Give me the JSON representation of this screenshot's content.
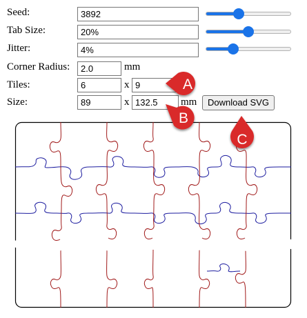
{
  "fields": {
    "seed": {
      "label": "Seed:",
      "value": "3892"
    },
    "tab_size": {
      "label": "Tab Size:",
      "value": "20%"
    },
    "jitter": {
      "label": "Jitter:",
      "value": "4%"
    },
    "corner_radius": {
      "label": "Corner Radius:",
      "value": "2.0",
      "unit": "mm"
    },
    "tiles": {
      "label": "Tiles:",
      "value_x": "6",
      "separator": "x",
      "value_y": "9"
    },
    "size": {
      "label": "Size:",
      "value_w": "89",
      "separator": "x",
      "value_h": "132.5",
      "unit": "mm"
    }
  },
  "sliders": {
    "seed": 0.39,
    "tab_size": 0.5,
    "jitter": 0.32
  },
  "buttons": {
    "download": "Download SVG"
  },
  "callouts": {
    "a": "A",
    "b": "B",
    "c": "C"
  },
  "colors": {
    "horizontal_cuts": "#1a1a9e",
    "vertical_cuts": "#a01818",
    "callout": "#d92a2a",
    "slider_accent": "#1a73e8"
  }
}
